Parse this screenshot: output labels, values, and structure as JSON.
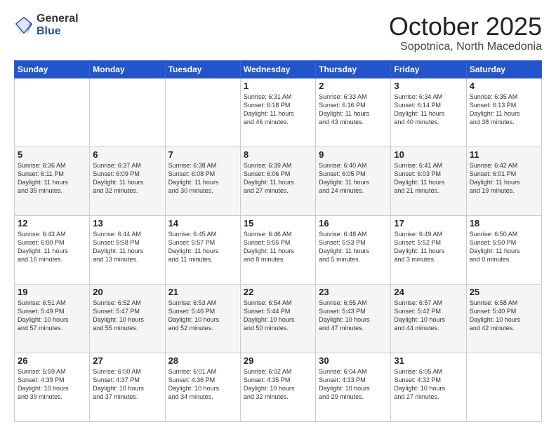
{
  "logo": {
    "general": "General",
    "blue": "Blue"
  },
  "header": {
    "title": "October 2025",
    "subtitle": "Sopotnica, North Macedonia"
  },
  "weekdays": [
    "Sunday",
    "Monday",
    "Tuesday",
    "Wednesday",
    "Thursday",
    "Friday",
    "Saturday"
  ],
  "weeks": [
    [
      {
        "day": "",
        "info": ""
      },
      {
        "day": "",
        "info": ""
      },
      {
        "day": "",
        "info": ""
      },
      {
        "day": "1",
        "info": "Sunrise: 6:31 AM\nSunset: 6:18 PM\nDaylight: 11 hours\nand 46 minutes."
      },
      {
        "day": "2",
        "info": "Sunrise: 6:33 AM\nSunset: 6:16 PM\nDaylight: 11 hours\nand 43 minutes."
      },
      {
        "day": "3",
        "info": "Sunrise: 6:34 AM\nSunset: 6:14 PM\nDaylight: 11 hours\nand 40 minutes."
      },
      {
        "day": "4",
        "info": "Sunrise: 6:35 AM\nSunset: 6:13 PM\nDaylight: 11 hours\nand 38 minutes."
      }
    ],
    [
      {
        "day": "5",
        "info": "Sunrise: 6:36 AM\nSunset: 6:11 PM\nDaylight: 11 hours\nand 35 minutes."
      },
      {
        "day": "6",
        "info": "Sunrise: 6:37 AM\nSunset: 6:09 PM\nDaylight: 11 hours\nand 32 minutes."
      },
      {
        "day": "7",
        "info": "Sunrise: 6:38 AM\nSunset: 6:08 PM\nDaylight: 11 hours\nand 30 minutes."
      },
      {
        "day": "8",
        "info": "Sunrise: 6:39 AM\nSunset: 6:06 PM\nDaylight: 11 hours\nand 27 minutes."
      },
      {
        "day": "9",
        "info": "Sunrise: 6:40 AM\nSunset: 6:05 PM\nDaylight: 11 hours\nand 24 minutes."
      },
      {
        "day": "10",
        "info": "Sunrise: 6:41 AM\nSunset: 6:03 PM\nDaylight: 11 hours\nand 21 minutes."
      },
      {
        "day": "11",
        "info": "Sunrise: 6:42 AM\nSunset: 6:01 PM\nDaylight: 11 hours\nand 19 minutes."
      }
    ],
    [
      {
        "day": "12",
        "info": "Sunrise: 6:43 AM\nSunset: 6:00 PM\nDaylight: 11 hours\nand 16 minutes."
      },
      {
        "day": "13",
        "info": "Sunrise: 6:44 AM\nSunset: 5:58 PM\nDaylight: 11 hours\nand 13 minutes."
      },
      {
        "day": "14",
        "info": "Sunrise: 6:45 AM\nSunset: 5:57 PM\nDaylight: 11 hours\nand 11 minutes."
      },
      {
        "day": "15",
        "info": "Sunrise: 6:46 AM\nSunset: 5:55 PM\nDaylight: 11 hours\nand 8 minutes."
      },
      {
        "day": "16",
        "info": "Sunrise: 6:48 AM\nSunset: 5:53 PM\nDaylight: 11 hours\nand 5 minutes."
      },
      {
        "day": "17",
        "info": "Sunrise: 6:49 AM\nSunset: 5:52 PM\nDaylight: 11 hours\nand 3 minutes."
      },
      {
        "day": "18",
        "info": "Sunrise: 6:50 AM\nSunset: 5:50 PM\nDaylight: 11 hours\nand 0 minutes."
      }
    ],
    [
      {
        "day": "19",
        "info": "Sunrise: 6:51 AM\nSunset: 5:49 PM\nDaylight: 10 hours\nand 57 minutes."
      },
      {
        "day": "20",
        "info": "Sunrise: 6:52 AM\nSunset: 5:47 PM\nDaylight: 10 hours\nand 55 minutes."
      },
      {
        "day": "21",
        "info": "Sunrise: 6:53 AM\nSunset: 5:46 PM\nDaylight: 10 hours\nand 52 minutes."
      },
      {
        "day": "22",
        "info": "Sunrise: 6:54 AM\nSunset: 5:44 PM\nDaylight: 10 hours\nand 50 minutes."
      },
      {
        "day": "23",
        "info": "Sunrise: 6:55 AM\nSunset: 5:43 PM\nDaylight: 10 hours\nand 47 minutes."
      },
      {
        "day": "24",
        "info": "Sunrise: 6:57 AM\nSunset: 5:42 PM\nDaylight: 10 hours\nand 44 minutes."
      },
      {
        "day": "25",
        "info": "Sunrise: 6:58 AM\nSunset: 5:40 PM\nDaylight: 10 hours\nand 42 minutes."
      }
    ],
    [
      {
        "day": "26",
        "info": "Sunrise: 5:59 AM\nSunset: 4:39 PM\nDaylight: 10 hours\nand 39 minutes."
      },
      {
        "day": "27",
        "info": "Sunrise: 6:00 AM\nSunset: 4:37 PM\nDaylight: 10 hours\nand 37 minutes."
      },
      {
        "day": "28",
        "info": "Sunrise: 6:01 AM\nSunset: 4:36 PM\nDaylight: 10 hours\nand 34 minutes."
      },
      {
        "day": "29",
        "info": "Sunrise: 6:02 AM\nSunset: 4:35 PM\nDaylight: 10 hours\nand 32 minutes."
      },
      {
        "day": "30",
        "info": "Sunrise: 6:04 AM\nSunset: 4:33 PM\nDaylight: 10 hours\nand 29 minutes."
      },
      {
        "day": "31",
        "info": "Sunrise: 6:05 AM\nSunset: 4:32 PM\nDaylight: 10 hours\nand 27 minutes."
      },
      {
        "day": "",
        "info": ""
      }
    ]
  ]
}
